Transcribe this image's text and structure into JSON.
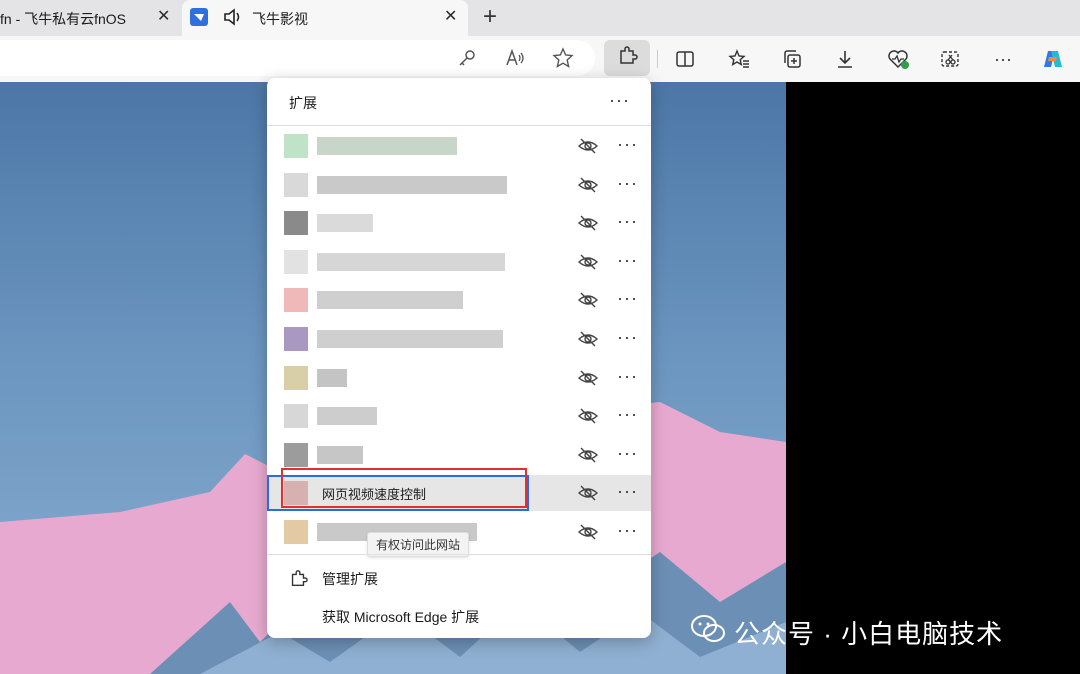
{
  "tabs": [
    {
      "title": "fn - 飞牛私有云fnOS",
      "close": "✕"
    },
    {
      "title": "飞牛影视",
      "close": "✕"
    }
  ],
  "new_tab": "+",
  "toolbar": {
    "icons": [
      "key-icon",
      "read-aloud-icon",
      "star-icon",
      "extensions-icon",
      "split-screen-icon",
      "favorites-icon",
      "collections-icon",
      "download-icon",
      "browser-essentials-icon",
      "screenshot-icon",
      "more-icon",
      "copilot-icon"
    ],
    "more": "···"
  },
  "extensions_panel": {
    "title": "扩展",
    "more": "···",
    "items": [
      {
        "name": "",
        "icon_color": "#bfe3c6",
        "blur_color": "#c8d6ca"
      },
      {
        "name": "",
        "icon_color": "#d9d9d9",
        "blur_color": "#c9c9c9"
      },
      {
        "name": "",
        "icon_color": "#8a8a8a",
        "blur_color": "#dadada"
      },
      {
        "name": "",
        "icon_color": "#e2e2e2",
        "blur_color": "#d6d6d6"
      },
      {
        "name": "",
        "icon_color": "#f0b9b9",
        "blur_color": "#cfcfcf"
      },
      {
        "name": "",
        "icon_color": "#a898c2",
        "blur_color": "#cfcfcf"
      },
      {
        "name": "",
        "icon_color": "#d8cfa8",
        "blur_color": "#c4c4c4"
      },
      {
        "name": "",
        "icon_color": "#d7d7d7",
        "blur_color": "#cdcdcd"
      },
      {
        "name": "",
        "icon_color": "#9c9c9c",
        "blur_color": "#c6c6c6"
      },
      {
        "name": "网页视频速度控制",
        "icon_color": "#d7b0b0",
        "blur_color": ""
      },
      {
        "name": "",
        "icon_color": "#e3c9a4",
        "blur_color": "#c9c9c9"
      }
    ],
    "tooltip": "有权访问此网站",
    "manage": "管理扩展",
    "get": "获取 Microsoft Edge 扩展"
  },
  "watermark": "公众号 · 小白电脑技术",
  "colors": {
    "highlight_blue": "#2b6be0",
    "highlight_red": "#e03030",
    "video_black": "#000000"
  }
}
